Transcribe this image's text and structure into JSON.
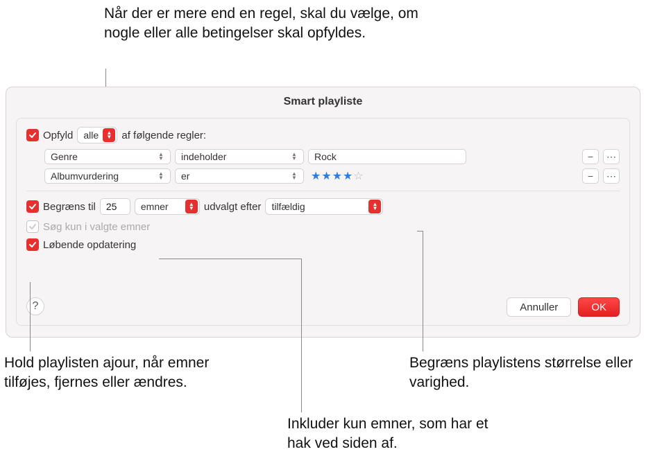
{
  "annotations": {
    "top": "Når der er mere end en regel, skal du vælge, om nogle eller alle betingelser skal opfyldes.",
    "bottom_left": "Hold playlisten ajour, når emner tilføjes, fjernes eller ændres.",
    "bottom_mid": "Inkluder kun emner, som har et hak ved siden af.",
    "bottom_right": "Begræns playlistens størrelse eller varighed."
  },
  "dialog": {
    "title": "Smart playliste",
    "match": {
      "checkbox_label_prefix": "Opfyld",
      "mode": "alle",
      "checkbox_label_suffix": "af følgende regler:"
    },
    "rules": [
      {
        "field": "Genre",
        "op": "indeholder",
        "value": "Rock"
      },
      {
        "field": "Albumvurdering",
        "op": "er",
        "stars": 4
      }
    ],
    "rule_buttons": {
      "minus": "−",
      "more": "⋯"
    },
    "limit": {
      "label": "Begræns til",
      "count": "25",
      "unit": "emner",
      "by_label": "udvalgt efter",
      "by_value": "tilfældig"
    },
    "only_checked": {
      "label": "Søg kun i valgte emner"
    },
    "live_update": {
      "label": "Løbende opdatering"
    },
    "help": "?",
    "buttons": {
      "cancel": "Annuller",
      "ok": "OK"
    }
  }
}
